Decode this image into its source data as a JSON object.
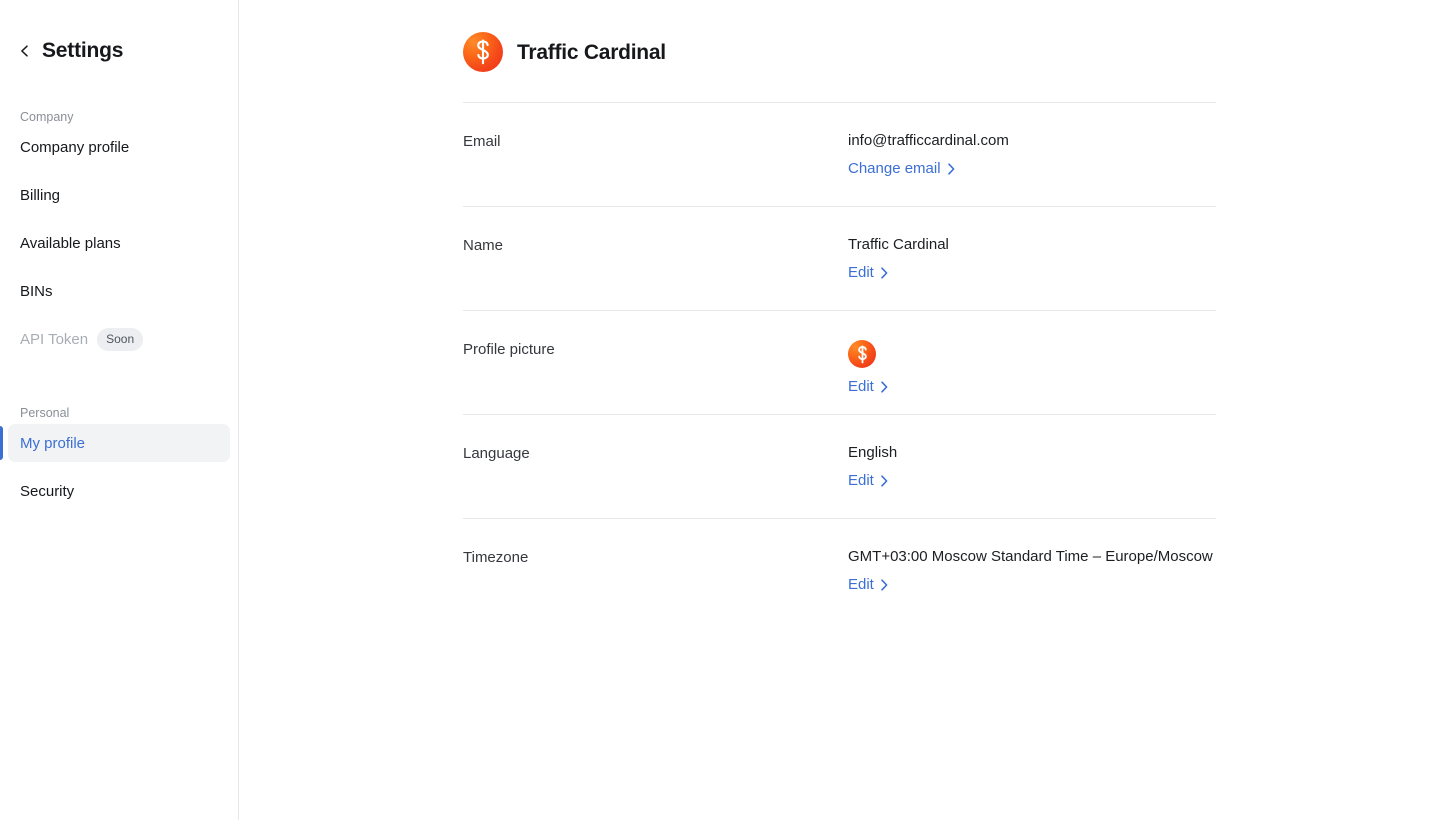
{
  "colors": {
    "accent_blue": "#3b6fd4",
    "text_primary": "#16181c",
    "text_secondary": "#8a8f98",
    "divider": "#e6e7ea",
    "active_bg": "#f2f3f5",
    "badge_bg": "#eceef1",
    "logo_orange_light": "#ff8a2b",
    "logo_orange_dark": "#ec2f17"
  },
  "sidebar": {
    "back_icon": "chevron-left-icon",
    "title": "Settings",
    "sections": [
      {
        "label": "Company",
        "items": [
          {
            "label": "Company profile",
            "active": false,
            "disabled": false,
            "badge": ""
          },
          {
            "label": "Billing",
            "active": false,
            "disabled": false,
            "badge": ""
          },
          {
            "label": "Available plans",
            "active": false,
            "disabled": false,
            "badge": ""
          },
          {
            "label": "BINs",
            "active": false,
            "disabled": false,
            "badge": ""
          },
          {
            "label": "API Token",
            "active": false,
            "disabled": true,
            "badge": "Soon"
          }
        ]
      },
      {
        "label": "Personal",
        "items": [
          {
            "label": "My profile",
            "active": true,
            "disabled": false,
            "badge": ""
          },
          {
            "label": "Security",
            "active": false,
            "disabled": false,
            "badge": ""
          }
        ]
      }
    ]
  },
  "header": {
    "logo_icon": "traffic-cardinal-logo-icon",
    "title": "Traffic Cardinal"
  },
  "profile": {
    "rows": [
      {
        "label": "Email",
        "value": "info@trafficcardinal.com",
        "value_kind": "text",
        "action": "Change email",
        "action_icon": "chevron-right-icon"
      },
      {
        "label": "Name",
        "value": "Traffic Cardinal",
        "value_kind": "text",
        "action": "Edit",
        "action_icon": "chevron-right-icon"
      },
      {
        "label": "Profile picture",
        "value": "",
        "value_kind": "avatar",
        "action": "Edit",
        "action_icon": "chevron-right-icon"
      },
      {
        "label": "Language",
        "value": "English",
        "value_kind": "text",
        "action": "Edit",
        "action_icon": "chevron-right-icon"
      },
      {
        "label": "Timezone",
        "value": "GMT+03:00 Moscow Standard Time – Europe/Moscow",
        "value_kind": "text",
        "action": "Edit",
        "action_icon": "chevron-right-icon"
      }
    ]
  }
}
